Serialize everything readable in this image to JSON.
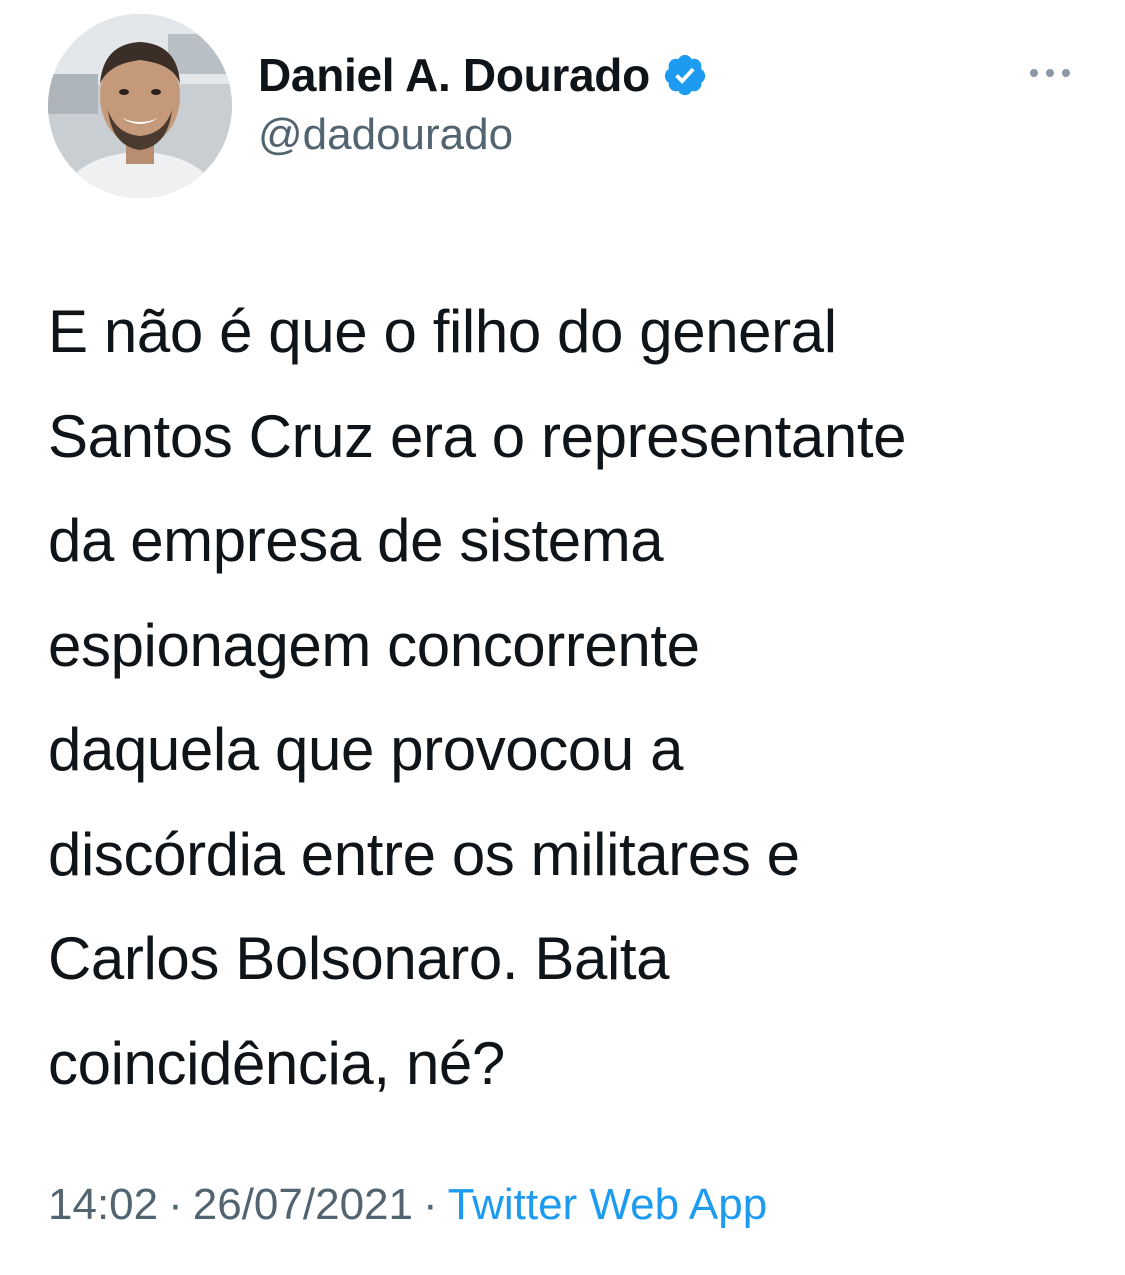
{
  "tweet": {
    "author": {
      "display_name": "Daniel A. Dourado",
      "handle": "@dadourado",
      "verified": true,
      "verified_color": "#1d9bf0"
    },
    "text": "E não é que o filho do general\nSantos Cruz era o representante\nda empresa de sistema\nespionagem concorrente\ndaquela que provocou a\ndiscórdia entre os militares e\nCarlos Bolsonaro. Baita\ncoincidência, né?",
    "time": "14:02",
    "date": "26/07/2021",
    "separator": "·",
    "source": "Twitter Web App"
  },
  "icons": {
    "verified": "verified-badge-icon",
    "more": "more-options-icon"
  },
  "colors": {
    "text_primary": "#0f1419",
    "text_secondary": "#536471",
    "accent": "#1d9bf0"
  }
}
